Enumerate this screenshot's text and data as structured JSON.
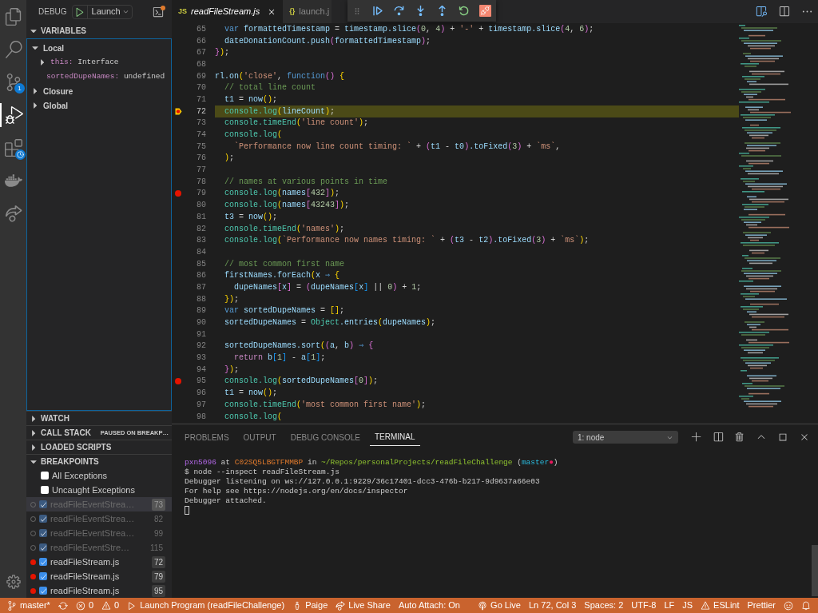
{
  "activity_bar": {
    "items": [
      {
        "kind": "files",
        "selected": false
      },
      {
        "kind": "search",
        "selected": false
      },
      {
        "kind": "source-control",
        "selected": false,
        "badge": "1"
      },
      {
        "kind": "debug",
        "selected": true
      },
      {
        "kind": "remote",
        "selected": false
      },
      {
        "kind": "docker",
        "selected": false
      },
      {
        "kind": "live-share",
        "selected": false
      }
    ]
  },
  "sidebar": {
    "title": "DEBUG",
    "config": "Launch",
    "variables": {
      "title": "VARIABLES",
      "expanded": true,
      "scopes": [
        {
          "label": "Local",
          "expanded": true,
          "children": [
            {
              "name": "this:",
              "value": "Interface",
              "expandable": true,
              "expanded": false
            },
            {
              "name": "sortedDupeNames:",
              "value": "undefined",
              "expandable": false
            }
          ]
        },
        {
          "label": "Closure",
          "expanded": false
        },
        {
          "label": "Global",
          "expanded": false
        }
      ]
    },
    "sections": [
      {
        "title": "WATCH",
        "expanded": false
      },
      {
        "title": "CALL STACK",
        "expanded": false,
        "status": "PAUSED ON BREAKP…"
      },
      {
        "title": "LOADED SCRIPTS",
        "expanded": false
      },
      {
        "title": "BREAKPOINTS",
        "expanded": true
      }
    ],
    "breakpoints": [
      {
        "kind": "exception",
        "label": "All Exceptions",
        "checked": false,
        "selected": false
      },
      {
        "kind": "exception",
        "label": "Uncaught Exceptions",
        "checked": false,
        "selected": false
      },
      {
        "kind": "file",
        "label": "readFileEventStrea…",
        "line": "73",
        "checked": true,
        "verified": false,
        "selected": true
      },
      {
        "kind": "file",
        "label": "readFileEventStrea…",
        "line": "82",
        "checked": true,
        "verified": false,
        "selected": false
      },
      {
        "kind": "file",
        "label": "readFileEventStrea…",
        "line": "99",
        "checked": true,
        "verified": false,
        "selected": false
      },
      {
        "kind": "file",
        "label": "readFileEventStre…",
        "line": "115",
        "checked": true,
        "verified": false,
        "selected": false
      },
      {
        "kind": "file",
        "label": "readFileStream.js",
        "line": "72",
        "checked": true,
        "verified": true,
        "selected": false
      },
      {
        "kind": "file",
        "label": "readFileStream.js",
        "line": "79",
        "checked": true,
        "verified": true,
        "selected": false
      },
      {
        "kind": "file",
        "label": "readFileStream.js",
        "line": "95",
        "checked": true,
        "verified": true,
        "selected": false
      }
    ]
  },
  "editor": {
    "tabs": [
      {
        "badge": "JS",
        "label": "readFileStream.js",
        "selected": true
      },
      {
        "badge": "{}",
        "label": "launch.j",
        "selected": false
      }
    ],
    "lines": [
      {
        "number": "65",
        "kind": "block",
        "breakpoint": false,
        "current": false,
        "tokens": [
          {
            "kind": "kw",
            "text": "var"
          },
          {
            "kind": "id",
            "text": " formattedTimestamp"
          },
          {
            "kind": "p",
            "text": " = "
          },
          {
            "kind": "id",
            "text": "timestamp.slice"
          },
          {
            "kind": "b2",
            "text": "("
          },
          {
            "kind": "num",
            "text": "0"
          },
          {
            "kind": "p",
            "text": ", "
          },
          {
            "kind": "num",
            "text": "4"
          },
          {
            "kind": "b2",
            "text": ")"
          },
          {
            "kind": "p",
            "text": " + "
          },
          {
            "kind": "str",
            "text": "'-'"
          },
          {
            "kind": "p",
            "text": " + "
          },
          {
            "kind": "id",
            "text": "timestamp.slice"
          },
          {
            "kind": "b2",
            "text": "("
          },
          {
            "kind": "num",
            "text": "4"
          },
          {
            "kind": "p",
            "text": ", "
          },
          {
            "kind": "num",
            "text": "6"
          },
          {
            "kind": "b2",
            "text": ")"
          },
          {
            "kind": "p",
            "text": ";"
          }
        ]
      },
      {
        "number": "66",
        "kind": "block",
        "breakpoint": false,
        "current": false,
        "tokens": [
          {
            "kind": "id",
            "text": "dateDonationCount.push"
          },
          {
            "kind": "b2",
            "text": "("
          },
          {
            "kind": "id",
            "text": "formattedTimestamp"
          },
          {
            "kind": "b2",
            "text": ")"
          },
          {
            "kind": "p",
            "text": ";"
          }
        ]
      },
      {
        "number": "67",
        "kind": "top",
        "breakpoint": false,
        "current": false,
        "tokens": [
          {
            "kind": "b2",
            "text": "}"
          },
          {
            "kind": "b1",
            "text": ")"
          },
          {
            "kind": "p",
            "text": ";"
          }
        ]
      },
      {
        "number": "68",
        "breakpoint": false,
        "current": false
      },
      {
        "number": "69",
        "kind": "top",
        "breakpoint": false,
        "current": false,
        "tokens": [
          {
            "kind": "id",
            "text": "rl.on"
          },
          {
            "kind": "b1",
            "text": "("
          },
          {
            "kind": "str",
            "text": "'close'"
          },
          {
            "kind": "p",
            "text": ", "
          },
          {
            "kind": "kw",
            "text": "function"
          },
          {
            "kind": "b2",
            "text": "()"
          },
          {
            "kind": "b1",
            "text": " {"
          }
        ]
      },
      {
        "number": "70",
        "kind": "block",
        "breakpoint": false,
        "current": false,
        "tokens": [
          {
            "kind": "com",
            "text": "// total line count"
          }
        ]
      },
      {
        "number": "71",
        "kind": "block",
        "breakpoint": false,
        "current": false,
        "tokens": [
          {
            "kind": "id",
            "text": "t1"
          },
          {
            "kind": "p",
            "text": " = "
          },
          {
            "kind": "id",
            "text": "now"
          },
          {
            "kind": "b1",
            "text": "()"
          },
          {
            "kind": "p",
            "text": ";"
          }
        ]
      },
      {
        "number": "72",
        "kind": "block",
        "breakpoint": true,
        "current": true,
        "tokens": [
          {
            "kind": "fn",
            "text": "console.log"
          },
          {
            "kind": "b1",
            "text": "("
          },
          {
            "kind": "id",
            "text": "lineCount"
          },
          {
            "kind": "b1",
            "text": ")"
          },
          {
            "kind": "p",
            "text": ";"
          }
        ]
      },
      {
        "number": "73",
        "kind": "block",
        "breakpoint": false,
        "current": false,
        "tokens": [
          {
            "kind": "fn",
            "text": "console.timeEnd"
          },
          {
            "kind": "b1",
            "text": "("
          },
          {
            "kind": "str",
            "text": "'line count'"
          },
          {
            "kind": "b1",
            "text": ")"
          },
          {
            "kind": "p",
            "text": ";"
          }
        ]
      },
      {
        "number": "74",
        "kind": "block",
        "breakpoint": false,
        "current": false,
        "tokens": [
          {
            "kind": "fn",
            "text": "console.log"
          },
          {
            "kind": "b1",
            "text": "("
          }
        ]
      },
      {
        "number": "75",
        "kind": "nested",
        "breakpoint": false,
        "current": false,
        "tokens": [
          {
            "kind": "str",
            "text": "`Performance now line count timing: `"
          },
          {
            "kind": "p",
            "text": " + "
          },
          {
            "kind": "b2",
            "text": "("
          },
          {
            "kind": "id",
            "text": "t1"
          },
          {
            "kind": "p",
            "text": " - "
          },
          {
            "kind": "id",
            "text": "t0"
          },
          {
            "kind": "b2",
            "text": ")"
          },
          {
            "kind": "id",
            "text": ".toFixed"
          },
          {
            "kind": "b2",
            "text": "("
          },
          {
            "kind": "num",
            "text": "3"
          },
          {
            "kind": "b2",
            "text": ")"
          },
          {
            "kind": "p",
            "text": " + "
          },
          {
            "kind": "str",
            "text": "`ms`"
          },
          {
            "kind": "p",
            "text": ","
          }
        ]
      },
      {
        "number": "76",
        "kind": "block",
        "breakpoint": false,
        "current": false,
        "tokens": [
          {
            "kind": "b1",
            "text": ")"
          },
          {
            "kind": "p",
            "text": ";"
          }
        ]
      },
      {
        "number": "77",
        "breakpoint": false,
        "current": false
      },
      {
        "number": "78",
        "kind": "block",
        "breakpoint": false,
        "current": false,
        "tokens": [
          {
            "kind": "com",
            "text": "// names at various points in time"
          }
        ]
      },
      {
        "number": "79",
        "kind": "block",
        "breakpoint": true,
        "current": false,
        "tokens": [
          {
            "kind": "fn",
            "text": "console.log"
          },
          {
            "kind": "b1",
            "text": "("
          },
          {
            "kind": "id",
            "text": "names"
          },
          {
            "kind": "b2",
            "text": "["
          },
          {
            "kind": "num",
            "text": "432"
          },
          {
            "kind": "b2",
            "text": "]"
          },
          {
            "kind": "b1",
            "text": ")"
          },
          {
            "kind": "p",
            "text": ";"
          }
        ]
      },
      {
        "number": "80",
        "kind": "block",
        "breakpoint": false,
        "current": false,
        "tokens": [
          {
            "kind": "fn",
            "text": "console.log"
          },
          {
            "kind": "b1",
            "text": "("
          },
          {
            "kind": "id",
            "text": "names"
          },
          {
            "kind": "b2",
            "text": "["
          },
          {
            "kind": "num",
            "text": "43243"
          },
          {
            "kind": "b2",
            "text": "]"
          },
          {
            "kind": "b1",
            "text": ")"
          },
          {
            "kind": "p",
            "text": ";"
          }
        ]
      },
      {
        "number": "81",
        "kind": "block",
        "breakpoint": false,
        "current": false,
        "tokens": [
          {
            "kind": "id",
            "text": "t3"
          },
          {
            "kind": "p",
            "text": " = "
          },
          {
            "kind": "id",
            "text": "now"
          },
          {
            "kind": "b1",
            "text": "()"
          },
          {
            "kind": "p",
            "text": ";"
          }
        ]
      },
      {
        "number": "82",
        "kind": "block",
        "breakpoint": false,
        "current": false,
        "tokens": [
          {
            "kind": "fn",
            "text": "console.timeEnd"
          },
          {
            "kind": "b1",
            "text": "("
          },
          {
            "kind": "str",
            "text": "'names'"
          },
          {
            "kind": "b1",
            "text": ")"
          },
          {
            "kind": "p",
            "text": ";"
          }
        ]
      },
      {
        "number": "83",
        "kind": "block",
        "breakpoint": false,
        "current": false,
        "tokens": [
          {
            "kind": "fn",
            "text": "console.log"
          },
          {
            "kind": "b1",
            "text": "("
          },
          {
            "kind": "str",
            "text": "`Performance now names timing: `"
          },
          {
            "kind": "p",
            "text": " + "
          },
          {
            "kind": "b2",
            "text": "("
          },
          {
            "kind": "id",
            "text": "t3"
          },
          {
            "kind": "p",
            "text": " - "
          },
          {
            "kind": "id",
            "text": "t2"
          },
          {
            "kind": "b2",
            "text": ")"
          },
          {
            "kind": "id",
            "text": ".toFixed"
          },
          {
            "kind": "b2",
            "text": "("
          },
          {
            "kind": "num",
            "text": "3"
          },
          {
            "kind": "b2",
            "text": ")"
          },
          {
            "kind": "p",
            "text": " + "
          },
          {
            "kind": "str",
            "text": "`ms`"
          },
          {
            "kind": "b1",
            "text": ")"
          },
          {
            "kind": "p",
            "text": ";"
          }
        ]
      },
      {
        "number": "84",
        "breakpoint": false,
        "current": false
      },
      {
        "number": "85",
        "kind": "block",
        "breakpoint": false,
        "current": false,
        "tokens": [
          {
            "kind": "com",
            "text": "// most common first name"
          }
        ]
      },
      {
        "number": "86",
        "kind": "block",
        "breakpoint": false,
        "current": false,
        "tokens": [
          {
            "kind": "id",
            "text": "firstNames.forEach"
          },
          {
            "kind": "b1",
            "text": "("
          },
          {
            "kind": "id",
            "text": "x"
          },
          {
            "kind": "kw",
            "text": " ⇒"
          },
          {
            "kind": "b1",
            "text": " {"
          }
        ]
      },
      {
        "number": "87",
        "kind": "nested",
        "breakpoint": false,
        "current": false,
        "tokens": [
          {
            "kind": "id",
            "text": "dupeNames"
          },
          {
            "kind": "b2",
            "text": "["
          },
          {
            "kind": "id",
            "text": "x"
          },
          {
            "kind": "b2",
            "text": "]"
          },
          {
            "kind": "p",
            "text": " = "
          },
          {
            "kind": "b2",
            "text": "("
          },
          {
            "kind": "id",
            "text": "dupeNames"
          },
          {
            "kind": "b3",
            "text": "["
          },
          {
            "kind": "id",
            "text": "x"
          },
          {
            "kind": "b3",
            "text": "]"
          },
          {
            "kind": "p",
            "text": " || "
          },
          {
            "kind": "num",
            "text": "0"
          },
          {
            "kind": "b2",
            "text": ")"
          },
          {
            "kind": "p",
            "text": " + "
          },
          {
            "kind": "num",
            "text": "1"
          },
          {
            "kind": "p",
            "text": ";"
          }
        ]
      },
      {
        "number": "88",
        "kind": "block",
        "breakpoint": false,
        "current": false,
        "tokens": [
          {
            "kind": "b1",
            "text": "}"
          },
          {
            "kind": "b1",
            "text": ")"
          },
          {
            "kind": "p",
            "text": ";"
          }
        ]
      },
      {
        "number": "89",
        "kind": "block",
        "breakpoint": false,
        "current": false,
        "tokens": [
          {
            "kind": "kw",
            "text": "var"
          },
          {
            "kind": "id",
            "text": " sortedDupeNames"
          },
          {
            "kind": "p",
            "text": " = "
          },
          {
            "kind": "b1",
            "text": "[]"
          },
          {
            "kind": "p",
            "text": ";"
          }
        ]
      },
      {
        "number": "90",
        "kind": "block",
        "breakpoint": false,
        "current": false,
        "tokens": [
          {
            "kind": "id",
            "text": "sortedDupeNames"
          },
          {
            "kind": "p",
            "text": " = "
          },
          {
            "kind": "fn",
            "text": "Object"
          },
          {
            "kind": "id",
            "text": ".entries"
          },
          {
            "kind": "b1",
            "text": "("
          },
          {
            "kind": "id",
            "text": "dupeNames"
          },
          {
            "kind": "b1",
            "text": ")"
          },
          {
            "kind": "p",
            "text": ";"
          }
        ]
      },
      {
        "number": "91",
        "breakpoint": false,
        "current": false
      },
      {
        "number": "92",
        "kind": "block",
        "breakpoint": false,
        "current": false,
        "tokens": [
          {
            "kind": "id",
            "text": "sortedDupeNames.sort"
          },
          {
            "kind": "b1",
            "text": "("
          },
          {
            "kind": "b2",
            "text": "("
          },
          {
            "kind": "id",
            "text": "a"
          },
          {
            "kind": "p",
            "text": ", "
          },
          {
            "kind": "id",
            "text": "b"
          },
          {
            "kind": "b2",
            "text": ")"
          },
          {
            "kind": "kw",
            "text": " ⇒"
          },
          {
            "kind": "b2",
            "text": " {"
          }
        ]
      },
      {
        "number": "93",
        "kind": "nested",
        "breakpoint": false,
        "current": false,
        "tokens": [
          {
            "kind": "ctl",
            "text": "return"
          },
          {
            "kind": "id",
            "text": " b"
          },
          {
            "kind": "b3",
            "text": "["
          },
          {
            "kind": "num",
            "text": "1"
          },
          {
            "kind": "b3",
            "text": "]"
          },
          {
            "kind": "p",
            "text": " - "
          },
          {
            "kind": "id",
            "text": "a"
          },
          {
            "kind": "b3",
            "text": "["
          },
          {
            "kind": "num",
            "text": "1"
          },
          {
            "kind": "b3",
            "text": "]"
          },
          {
            "kind": "p",
            "text": ";"
          }
        ]
      },
      {
        "number": "94",
        "kind": "block",
        "breakpoint": false,
        "current": false,
        "tokens": [
          {
            "kind": "b2",
            "text": "}"
          },
          {
            "kind": "b1",
            "text": ")"
          },
          {
            "kind": "p",
            "text": ";"
          }
        ]
      },
      {
        "number": "95",
        "kind": "block",
        "breakpoint": true,
        "current": false,
        "tokens": [
          {
            "kind": "fn",
            "text": "console.log"
          },
          {
            "kind": "b1",
            "text": "("
          },
          {
            "kind": "id",
            "text": "sortedDupeNames"
          },
          {
            "kind": "b2",
            "text": "["
          },
          {
            "kind": "num",
            "text": "0"
          },
          {
            "kind": "b2",
            "text": "]"
          },
          {
            "kind": "b1",
            "text": ")"
          },
          {
            "kind": "p",
            "text": ";"
          }
        ]
      },
      {
        "number": "96",
        "kind": "block",
        "breakpoint": false,
        "current": false,
        "tokens": [
          {
            "kind": "id",
            "text": "t1"
          },
          {
            "kind": "p",
            "text": " = "
          },
          {
            "kind": "id",
            "text": "now"
          },
          {
            "kind": "b1",
            "text": "()"
          },
          {
            "kind": "p",
            "text": ";"
          }
        ]
      },
      {
        "number": "97",
        "kind": "block",
        "breakpoint": false,
        "current": false,
        "tokens": [
          {
            "kind": "fn",
            "text": "console.timeEnd"
          },
          {
            "kind": "b1",
            "text": "("
          },
          {
            "kind": "str",
            "text": "'most common first name'"
          },
          {
            "kind": "b1",
            "text": ")"
          },
          {
            "kind": "p",
            "text": ";"
          }
        ]
      },
      {
        "number": "98",
        "kind": "block",
        "breakpoint": false,
        "current": false,
        "tokens": [
          {
            "kind": "fn",
            "text": "console.log"
          },
          {
            "kind": "b1",
            "text": "("
          }
        ]
      }
    ]
  },
  "panel": {
    "tabs": [
      {
        "label": "PROBLEMS",
        "selected": false
      },
      {
        "label": "OUTPUT",
        "selected": false
      },
      {
        "label": "DEBUG CONSOLE",
        "selected": false
      },
      {
        "label": "TERMINAL",
        "selected": true
      }
    ],
    "terminal_select": "1: node",
    "terminal_lines": [
      [
        {
          "kind": "user",
          "text": "pxn5096"
        },
        {
          "kind": "plain",
          "text": " at "
        },
        {
          "kind": "host",
          "text": "C02SQ5LBGTFMMBP"
        },
        {
          "kind": "plain",
          "text": " in "
        },
        {
          "kind": "path",
          "text": "~/Repos/personalProjects/readFileChallenge"
        },
        {
          "kind": "plain",
          "text": " ("
        },
        {
          "kind": "branch",
          "text": "master"
        },
        {
          "kind": "dirty",
          "text": "●"
        },
        {
          "kind": "plain",
          "text": ")"
        }
      ],
      [
        {
          "kind": "plain",
          "text": "$ node --inspect readFileStream.js"
        }
      ],
      [
        {
          "kind": "plain",
          "text": "Debugger listening on ws://127.0.0.1:9229/36c17401-dcc3-476b-b217-9d9637a66e03"
        }
      ],
      [
        {
          "kind": "plain",
          "text": "For help see https://nodejs.org/en/docs/inspector"
        }
      ],
      [
        {
          "kind": "plain",
          "text": "Debugger attached."
        }
      ]
    ]
  },
  "status_bar": {
    "left": [
      {
        "kind": "branch",
        "text": "master*"
      },
      {
        "kind": "sync"
      },
      {
        "kind": "errors",
        "text": "0"
      },
      {
        "kind": "warnings",
        "text": "0"
      },
      {
        "kind": "launch",
        "text": "Launch Program (readFileChallenge)"
      },
      {
        "kind": "user",
        "text": "Paige"
      },
      {
        "kind": "live-share",
        "text": "Live Share"
      },
      {
        "kind": "plain",
        "text": "Auto Attach: On"
      }
    ],
    "right": [
      {
        "kind": "go-live",
        "text": "Go Live"
      },
      {
        "kind": "plain",
        "text": "Ln 72, Col 3"
      },
      {
        "kind": "plain",
        "text": "Spaces: 2"
      },
      {
        "kind": "plain",
        "text": "UTF-8"
      },
      {
        "kind": "plain",
        "text": "LF"
      },
      {
        "kind": "plain",
        "text": "JS"
      },
      {
        "kind": "eslint",
        "text": "ESLint"
      },
      {
        "kind": "plain",
        "text": "Prettier"
      },
      {
        "kind": "feedback"
      },
      {
        "kind": "bell"
      }
    ]
  }
}
